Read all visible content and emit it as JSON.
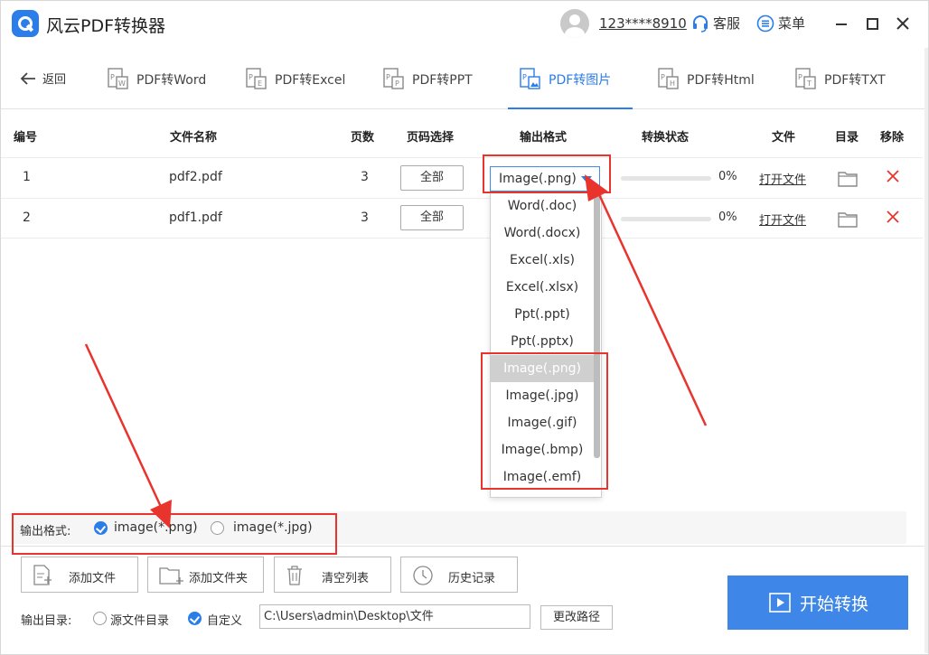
{
  "app": {
    "title": "风云PDF转换器"
  },
  "user": {
    "name": "123****8910"
  },
  "header": {
    "service_label": "客服",
    "menu_label": "菜单"
  },
  "nav": {
    "back_label": "返回",
    "tabs": [
      {
        "label": "PDF转Word",
        "icon": "W"
      },
      {
        "label": "PDF转Excel",
        "icon": "E"
      },
      {
        "label": "PDF转PPT",
        "icon": "P"
      },
      {
        "label": "PDF转图片",
        "icon": "P"
      },
      {
        "label": "PDF转Html",
        "icon": "H"
      },
      {
        "label": "PDF转TXT",
        "icon": "T"
      }
    ],
    "active_tab": "PDF转图片"
  },
  "table": {
    "headers": {
      "index": "编号",
      "filename": "文件名称",
      "pages": "页数",
      "page_select": "页码选择",
      "output_format": "输出格式",
      "status": "转换状态",
      "file": "文件",
      "dir": "目录",
      "remove": "移除"
    },
    "rows": [
      {
        "index": "1",
        "filename": "pdf2.pdf",
        "pages": "3",
        "page_select": "全部",
        "format": "Image(.png)",
        "progress": "0%",
        "open": "打开文件"
      },
      {
        "index": "2",
        "filename": "pdf1.pdf",
        "pages": "3",
        "page_select": "全部",
        "format": "",
        "progress": "0%",
        "open": "打开文件"
      }
    ]
  },
  "dropdown": {
    "options": [
      "Word(.doc)",
      "Word(.docx)",
      "Excel(.xls)",
      "Excel(.xlsx)",
      "Ppt(.ppt)",
      "Ppt(.pptx)",
      "Image(.png)",
      "Image(.jpg)",
      "Image(.gif)",
      "Image(.bmp)",
      "Image(.emf)"
    ],
    "selected": "Image(.png)"
  },
  "output_format": {
    "label": "输出格式:",
    "options": [
      {
        "label": "image(*.png)",
        "checked": true
      },
      {
        "label": "image(*.jpg)",
        "checked": false
      }
    ]
  },
  "actions": {
    "add_file": "添加文件",
    "add_folder": "添加文件夹",
    "clear_list": "清空列表",
    "history": "历史记录"
  },
  "output_dir": {
    "label": "输出目录:",
    "source_option": "源文件目录",
    "custom_option": "自定义",
    "path": "C:\\Users\\admin\\Desktop\\文件",
    "change_button": "更改路径"
  },
  "start_button": "开始转换",
  "colors": {
    "accent": "#2b7de9",
    "annotation": "#e8342d",
    "delete": "#e8342d"
  }
}
